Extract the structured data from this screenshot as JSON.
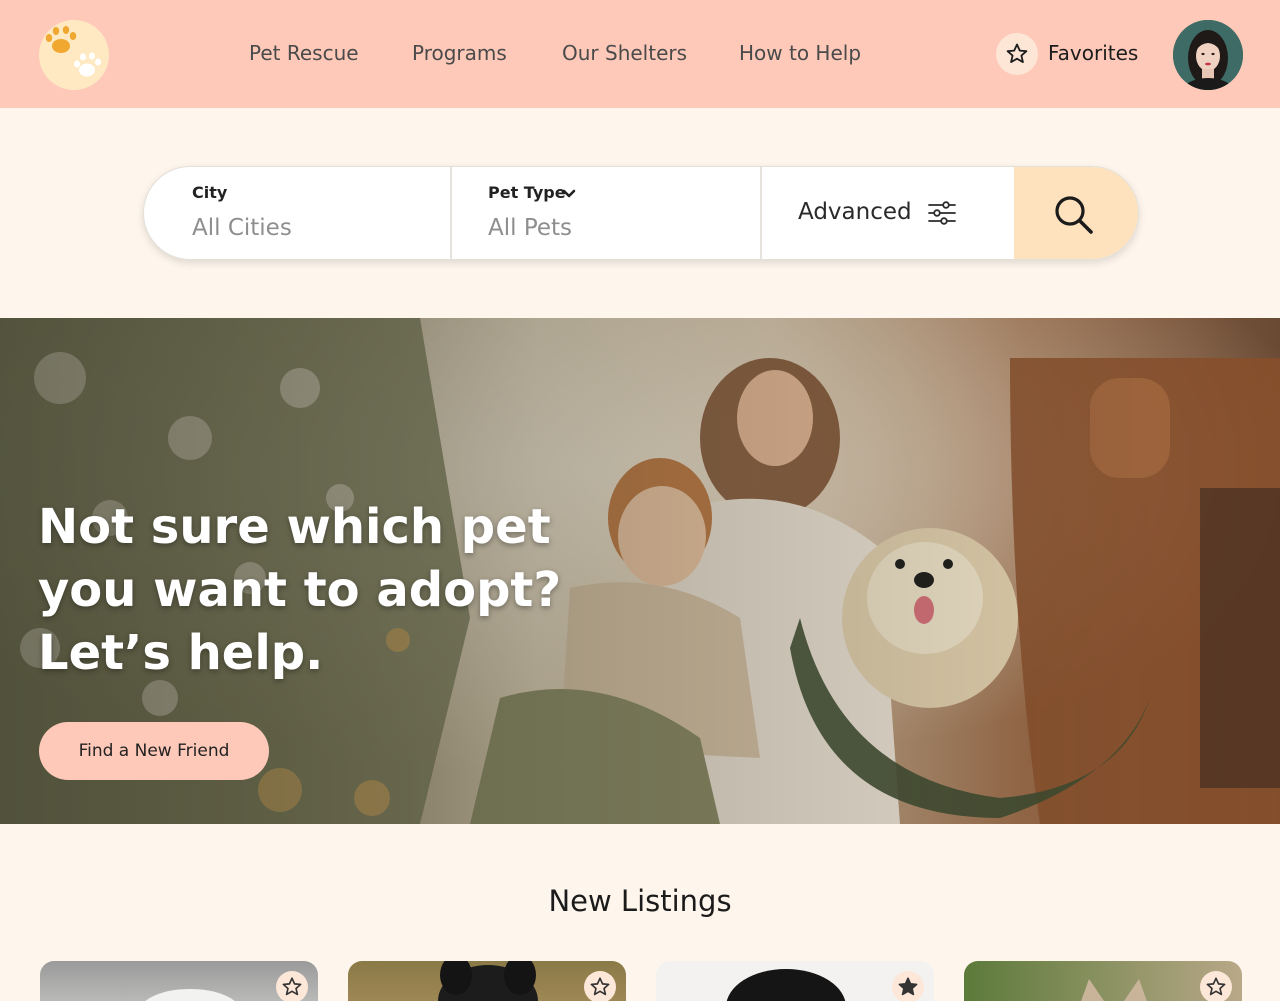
{
  "brand": {
    "logo_icon": "paw-logo-icon"
  },
  "nav": {
    "items": [
      {
        "label": "Pet Rescue"
      },
      {
        "label": "Programs"
      },
      {
        "label": "Our Shelters"
      },
      {
        "label": "How to Help"
      }
    ],
    "favorites_label": "Favorites",
    "favorites_icon": "star-icon",
    "avatar_icon": "user-avatar"
  },
  "search": {
    "city_label": "City",
    "city_value": "All Cities",
    "pet_type_label": "Pet Type",
    "pet_type_value": "All Pets",
    "advanced_label": "Advanced",
    "advanced_icon": "sliders-icon",
    "submit_icon": "search-icon"
  },
  "hero": {
    "title_lines": [
      "Not sure which pet",
      "you want to adopt?",
      "Let’s help."
    ],
    "cta_label": "Find a New Friend"
  },
  "listings": {
    "title": "New Listings",
    "cards": [
      {
        "favorited": false
      },
      {
        "favorited": false
      },
      {
        "favorited": true
      },
      {
        "favorited": false
      }
    ]
  },
  "colors": {
    "header_bg": "#fec9b9",
    "page_bg": "#fef6ec",
    "search_button_bg": "#fde2bd",
    "cta_bg": "#fec9b9",
    "logo_paw": "#f0a830"
  }
}
